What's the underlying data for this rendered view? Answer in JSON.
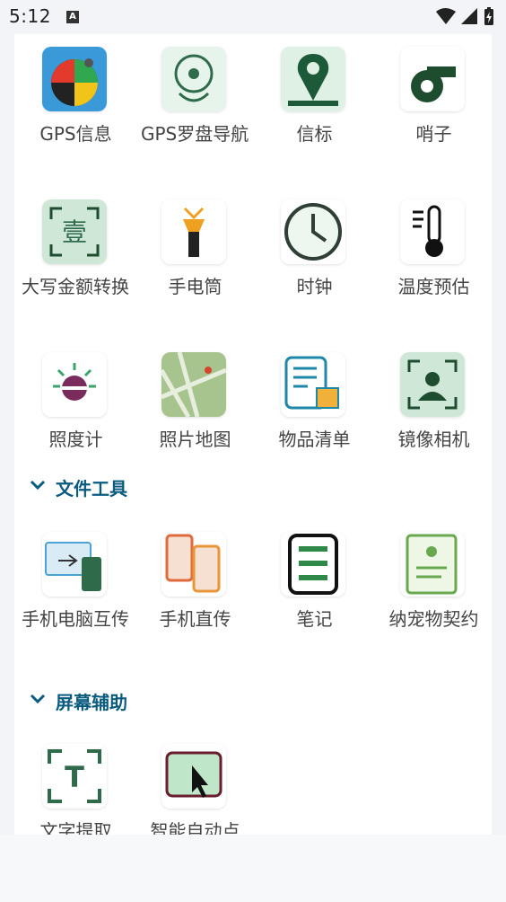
{
  "status_bar": {
    "time": "5:12",
    "notification_icon": "a-letter-icon",
    "icons": [
      "wifi-icon",
      "signal-icon",
      "battery-charging-icon"
    ]
  },
  "sections": [
    {
      "title": "",
      "items": [
        {
          "label": "GPS信息",
          "icon": "gps-info-icon"
        },
        {
          "label": "GPS罗盘导航",
          "icon": "compass-navigation-icon"
        },
        {
          "label": "信标",
          "icon": "beacon-icon"
        },
        {
          "label": "哨子",
          "icon": "whistle-icon"
        },
        {
          "label": "大写金额转换",
          "icon": "capital-amount-icon"
        },
        {
          "label": "手电筒",
          "icon": "flashlight-icon"
        },
        {
          "label": "时钟",
          "icon": "clock-icon"
        },
        {
          "label": "温度预估",
          "icon": "thermometer-icon"
        },
        {
          "label": "照度计",
          "icon": "light-meter-icon"
        },
        {
          "label": "照片地图",
          "icon": "photo-map-icon"
        },
        {
          "label": "物品清单",
          "icon": "item-list-icon"
        },
        {
          "label": "镜像相机",
          "icon": "mirror-camera-icon"
        }
      ]
    },
    {
      "title": "文件工具",
      "items": [
        {
          "label": "手机电脑互传",
          "icon": "phone-pc-transfer-icon"
        },
        {
          "label": "手机直传",
          "icon": "phone-direct-transfer-icon"
        },
        {
          "label": "笔记",
          "icon": "notes-icon"
        },
        {
          "label": "纳宠物契约",
          "icon": "pet-contract-icon"
        }
      ]
    },
    {
      "title": "屏幕辅助",
      "items": [
        {
          "label": "文字提取",
          "icon": "text-extract-icon"
        },
        {
          "label": "智能自动点",
          "icon": "auto-click-icon"
        }
      ]
    }
  ],
  "colors": {
    "accent": "#0b5b7e",
    "label": "#444444",
    "background": "#f2f4f8"
  }
}
